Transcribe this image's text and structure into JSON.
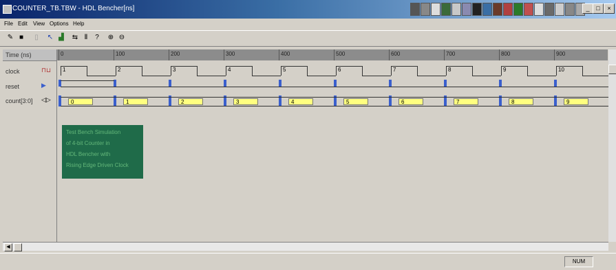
{
  "window": {
    "title": "COUNTER_TB.TBW - HDL Bencher[ns]"
  },
  "menu": [
    "File",
    "Edit",
    "View",
    "Options",
    "Help"
  ],
  "toolbar": [
    "pencil-icon",
    "save-icon",
    "copy-icon",
    "select-icon",
    "chart-icon",
    "step-icon",
    "pause-icon",
    "help-icon",
    "zoom-in-icon",
    "zoom-out-icon"
  ],
  "signals": {
    "time": "Time (ns)",
    "clock": "clock",
    "reset": "reset",
    "count": "count[3:0]"
  },
  "ruler_ticks": [
    "0",
    "100",
    "200",
    "300",
    "400",
    "500",
    "600",
    "700",
    "800",
    "900"
  ],
  "clock_cycles": [
    "1",
    "2",
    "3",
    "4",
    "5",
    "6",
    "7",
    "8",
    "9",
    "10"
  ],
  "count_values": [
    "0",
    "1",
    "2",
    "3",
    "4",
    "5",
    "6",
    "7",
    "8",
    "9"
  ],
  "note_lines": [
    "Test Bench Simulation",
    "of 4-bit Counter in",
    "HDL Bencher with",
    "Rising Edge Driven Clock"
  ],
  "status": {
    "num": "NUM"
  },
  "colors": {
    "titlebar": "#0a246a",
    "bus": "#ffff80",
    "edge": "#3a5fcd",
    "note": "#1f6b49"
  }
}
